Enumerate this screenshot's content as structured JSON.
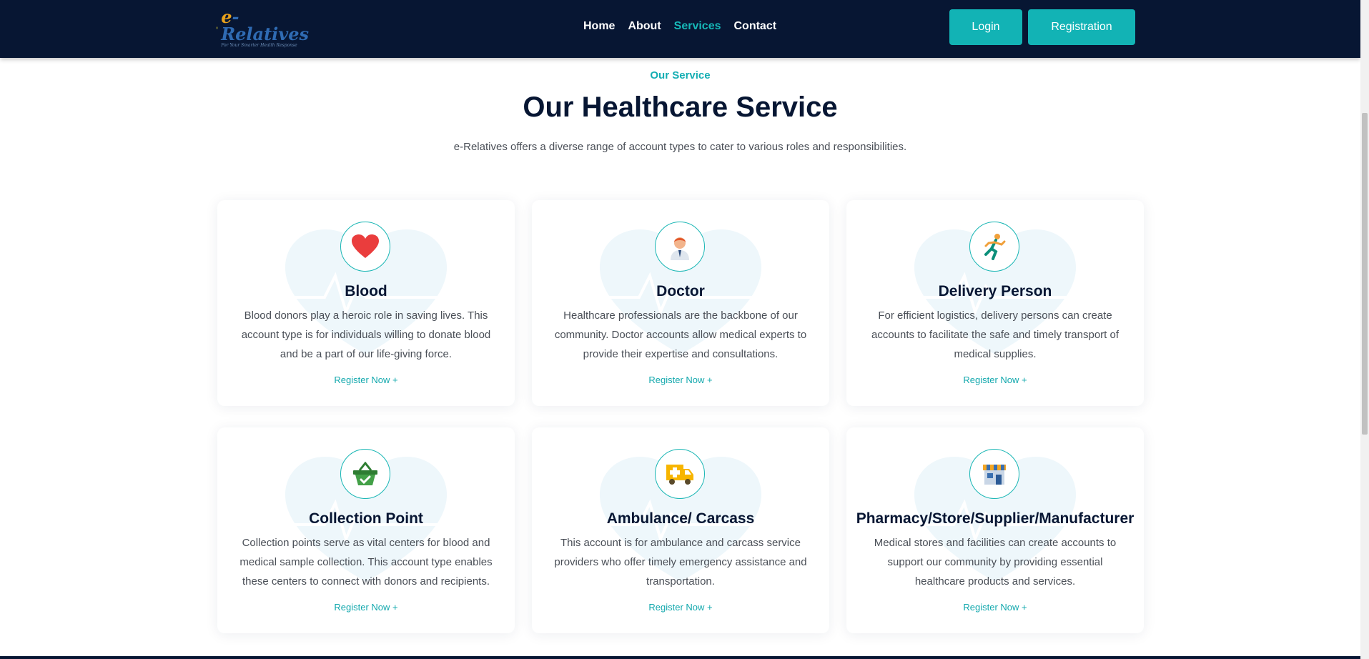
{
  "nav": {
    "logo_e": "e",
    "logo_word": "-Relatives",
    "logo_tagline": "For Your Smarter Health Response",
    "links": [
      "Home",
      "About",
      "Services",
      "Contact"
    ],
    "active": "Services",
    "login": "Login",
    "registration": "Registration"
  },
  "section": {
    "eyebrow": "Our Service",
    "heading": "Our Healthcare Service",
    "lead": "e-Relatives offers a diverse range of account types to cater to various roles and responsibilities."
  },
  "cards": [
    {
      "icon": "heart-icon",
      "title": "Blood",
      "desc": "Blood donors play a heroic role in saving lives. This account type is for individuals willing to donate blood and be a part of our life-giving force.",
      "link": "Register Now +"
    },
    {
      "icon": "doctor-icon",
      "title": "Doctor",
      "desc": "Healthcare professionals are the backbone of our community. Doctor accounts allow medical experts to provide their expertise and consultations.",
      "link": "Register Now +"
    },
    {
      "icon": "runner-icon",
      "title": "Delivery Person",
      "desc": "For efficient logistics, delivery persons can create accounts to facilitate the safe and timely transport of medical supplies.",
      "link": "Register Now +"
    },
    {
      "icon": "basket-icon",
      "title": "Collection Point",
      "desc": "Collection points serve as vital centers for blood and medical sample collection. This account type enables these centers to connect with donors and recipients.",
      "link": "Register Now +"
    },
    {
      "icon": "ambulance-icon",
      "title": "Ambulance/ Carcass",
      "desc": "This account is for ambulance and carcass service providers who offer timely emergency assistance and transportation.",
      "link": "Register Now +"
    },
    {
      "icon": "store-icon",
      "title": "Pharmacy/Store/Supplier/Manufacturer",
      "desc": "Medical stores and facilities can create accounts to support our community by providing essential healthcare products and services.",
      "link": "Register Now +"
    }
  ],
  "colors": {
    "navy": "#071633",
    "teal": "#12b3b5"
  }
}
